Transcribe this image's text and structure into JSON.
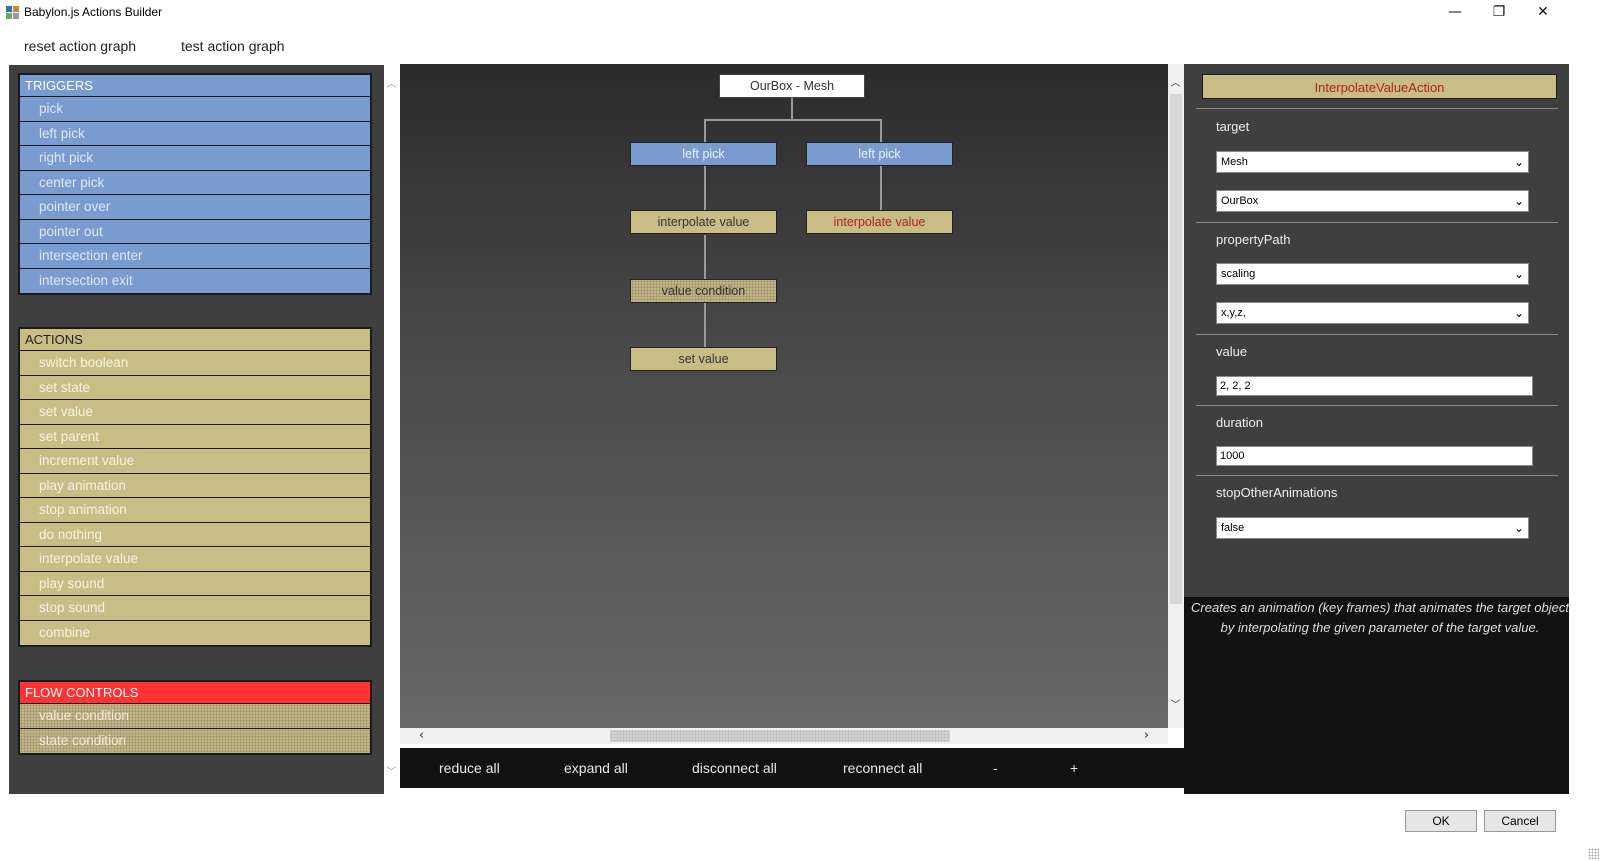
{
  "window": {
    "title": "Babylon.js Actions Builder",
    "minimize_glyph": "—",
    "maximize_glyph": "❐",
    "close_glyph": "✕"
  },
  "menu": {
    "reset_label": "reset action graph",
    "test_label": "test action graph"
  },
  "triggers": {
    "header": "TRIGGERS",
    "items": [
      "pick",
      "left pick",
      "right pick",
      "center pick",
      "pointer over",
      "pointer out",
      "intersection enter",
      "intersection exit"
    ]
  },
  "actions": {
    "header": "ACTIONS",
    "items": [
      "switch boolean",
      "set state",
      "set value",
      "set parent",
      "increment value",
      "play animation",
      "stop animation",
      "do nothing",
      "interpolate value",
      "play sound",
      "stop sound",
      "combine"
    ]
  },
  "flow_controls": {
    "header": "FLOW CONTROLS",
    "items": [
      "value condition",
      "state condition"
    ]
  },
  "graph": {
    "root": "OurBox - Mesh",
    "trigger_1": "left pick",
    "trigger_2": "left pick",
    "action_1": "interpolate value",
    "action_2": "interpolate value",
    "condition": "value condition",
    "action_3": "set value"
  },
  "toolbar": {
    "reduce_all": "reduce all",
    "expand_all": "expand all",
    "disconnect_all": "disconnect all",
    "reconnect_all": "reconnect all",
    "zoom_out": "-",
    "zoom_in": "+"
  },
  "properties": {
    "action_name": "InterpolateValueAction",
    "target_label": "target",
    "target_type": "Mesh",
    "target_name": "OurBox",
    "property_path_label": "propertyPath",
    "property_path": "scaling",
    "property_sub": "x,y,z,",
    "value_label": "value",
    "value": "2, 2, 2",
    "duration_label": "duration",
    "duration": "1000",
    "stop_other_label": "stopOtherAnimations",
    "stop_other": "false",
    "description": "Creates an animation (key frames) that animates the target object by interpolating the given parameter of the target value."
  },
  "dialog": {
    "ok_label": "OK",
    "cancel_label": "Cancel"
  },
  "colors": {
    "trigger": "#7a9bd0",
    "action": "#c8bd84",
    "flow_header": "#ff3333",
    "selected_text": "#b22222",
    "panel_bg": "#3f3f3f"
  },
  "icons": {
    "dropdown": "chevron-down-icon",
    "scroll_up": "chevron-up-icon",
    "scroll_down": "chevron-down-icon",
    "scroll_left": "chevron-left-icon",
    "scroll_right": "chevron-right-icon"
  }
}
